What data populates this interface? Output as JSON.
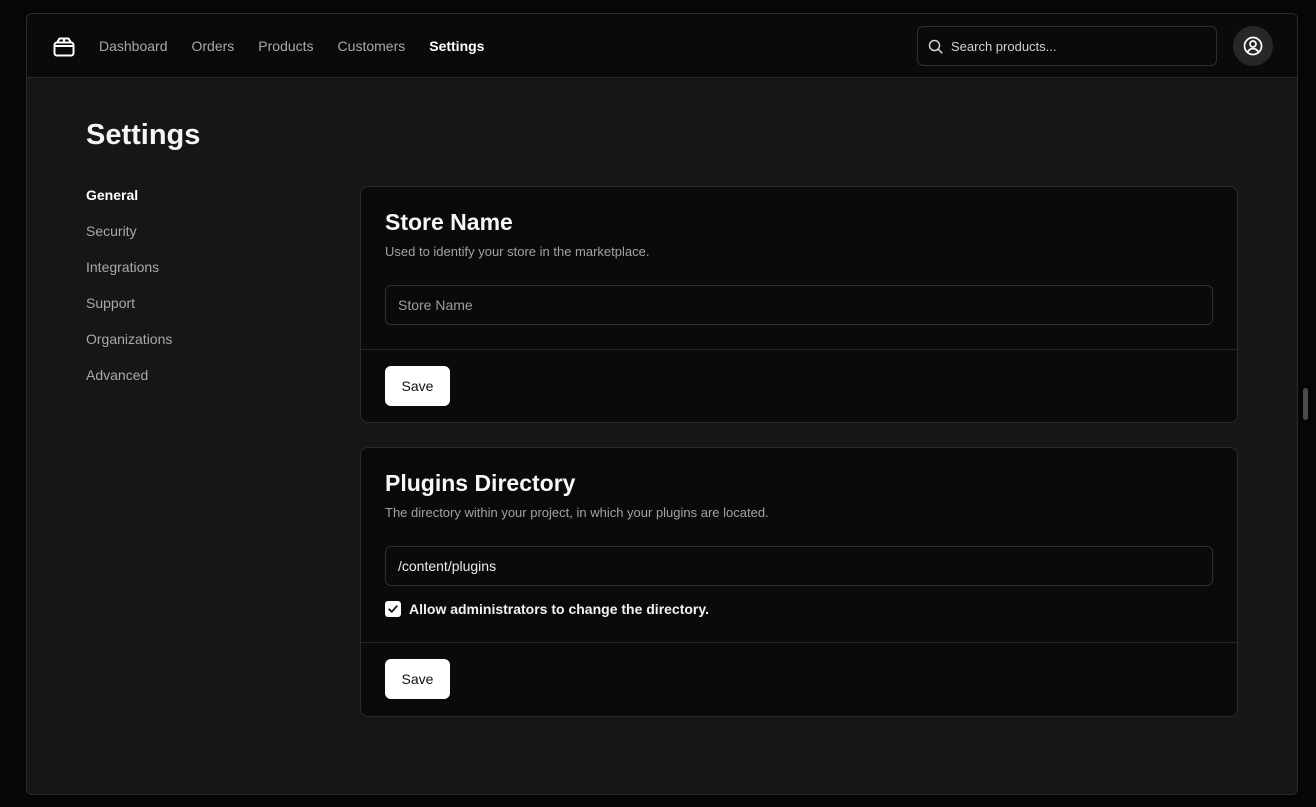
{
  "nav": {
    "items": [
      {
        "label": "Dashboard"
      },
      {
        "label": "Orders"
      },
      {
        "label": "Products"
      },
      {
        "label": "Customers"
      },
      {
        "label": "Settings"
      }
    ],
    "active": "Settings"
  },
  "search": {
    "placeholder": "Search products...",
    "icon": "search-icon"
  },
  "user": {
    "icon": "user-circle-icon"
  },
  "page": {
    "title": "Settings"
  },
  "sidebar": {
    "items": [
      {
        "label": "General"
      },
      {
        "label": "Security"
      },
      {
        "label": "Integrations"
      },
      {
        "label": "Support"
      },
      {
        "label": "Organizations"
      },
      {
        "label": "Advanced"
      }
    ],
    "active": "General"
  },
  "store_card": {
    "title": "Store Name",
    "description": "Used to identify your store in the marketplace.",
    "input_placeholder": "Store Name",
    "input_value": "",
    "save_label": "Save"
  },
  "plugins_card": {
    "title": "Plugins Directory",
    "description": "The directory within your project, in which your plugins are located.",
    "input_value": "/content/plugins",
    "checkbox_label": "Allow administrators to change the directory.",
    "checkbox_checked": true,
    "save_label": "Save"
  },
  "colors": {
    "background": "#161617",
    "card": "#0a0a0b",
    "accent_button": "#ffffff"
  }
}
